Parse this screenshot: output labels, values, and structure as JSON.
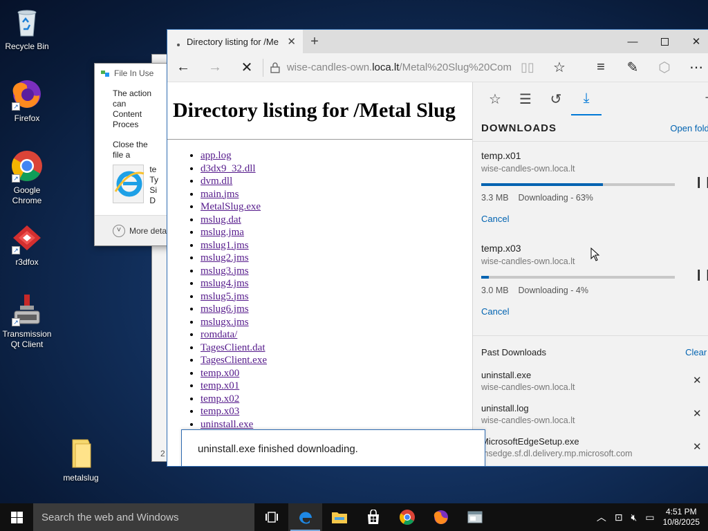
{
  "desktop": {
    "icons": [
      {
        "label": "Recycle Bin"
      },
      {
        "label": "Firefox"
      },
      {
        "label": "Google Chrome"
      },
      {
        "label": "r3dfox"
      },
      {
        "label": "Transmission Qt Client"
      },
      {
        "label": "metalslug"
      }
    ]
  },
  "dialog": {
    "title": "File In Use",
    "line1": "The action can",
    "line2": "Content Proces",
    "line3": "Close the file a",
    "file_frag1": "te",
    "file_frag2": "Ty",
    "file_frag3": "Si",
    "file_frag4": "D",
    "more_details": "More deta"
  },
  "behind_window": {
    "number": "2"
  },
  "browser": {
    "tab_title": "Directory listing for /Me",
    "address_prefix": "wise-candles-own.",
    "address_host": "loca.lt",
    "address_path": "/Metal%20Slug%20Com",
    "page_heading": "Directory listing for /Metal Slug",
    "files": [
      "app.log",
      "d3dx9_32.dll",
      "dvm.dll",
      "main.jms",
      "MetalSlug.exe",
      "mslug.dat",
      "mslug.jma",
      "mslug1.jms",
      "mslug2.jms",
      "mslug3.jms",
      "mslug4.jms",
      "mslug5.jms",
      "mslug6.jms",
      "mslugx.jms",
      "romdata/",
      "TagesClient.dat",
      "TagesClient.exe",
      "temp.x00",
      "temp.x01",
      "temp.x02",
      "temp.x03",
      "uninstall.exe"
    ],
    "notice": "uninstall.exe finished downloading."
  },
  "downloads": {
    "heading": "DOWNLOADS",
    "open_folder": "Open folde",
    "active": [
      {
        "name": "temp.x01",
        "source": "wise-candles-own.loca.lt",
        "status": "3.3 MB    Downloading - 63%",
        "progress": 0.63,
        "cancel": "Cancel"
      },
      {
        "name": "temp.x03",
        "source": "wise-candles-own.loca.lt",
        "status": "3.0 MB    Downloading - 4%",
        "progress": 0.04,
        "cancel": "Cancel"
      }
    ],
    "past_heading": "Past Downloads",
    "clear_all": "Clear a",
    "past": [
      {
        "name": "uninstall.exe",
        "source": "wise-candles-own.loca.lt"
      },
      {
        "name": "uninstall.log",
        "source": "wise-candles-own.loca.lt"
      },
      {
        "name": "MicrosoftEdgeSetup.exe",
        "source": "msedge.sf.dl.delivery.mp.microsoft.com"
      }
    ]
  },
  "taskbar": {
    "search_placeholder": "Search the web and Windows",
    "time": "4:51 PM",
    "date": "10/8/2025"
  },
  "colors": {
    "accent": "#0078d7",
    "link_visited": "#551a8b",
    "progress": "#0063b1"
  }
}
